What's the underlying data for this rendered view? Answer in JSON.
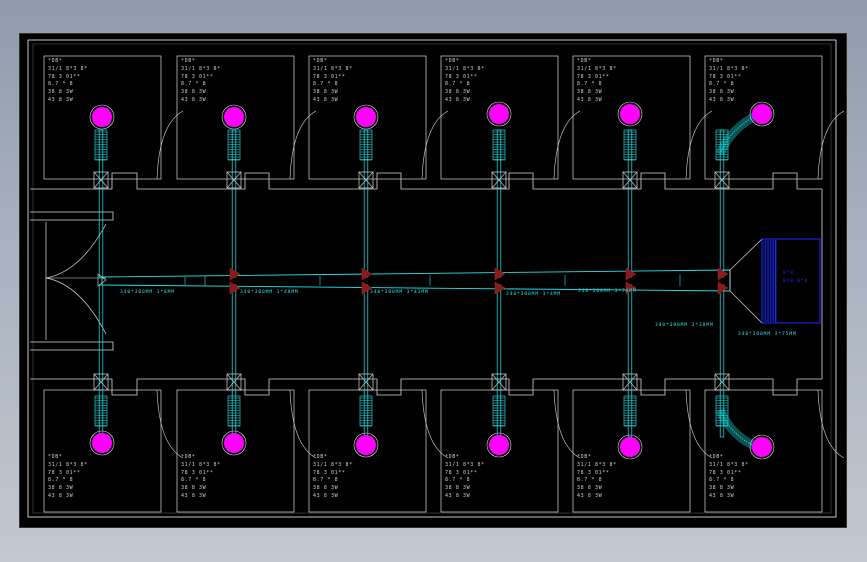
{
  "room_spec_lines": [
    "*DB*",
    "31/1 8*3 8*",
    "78 3 01**",
    "8.7 * 8",
    "38 8 3W",
    "43 8 3W"
  ],
  "duct_labels": [
    "340*300MM 3*8MM",
    "340*300MM 3*48MM",
    "340*300MM 3*43MM",
    "340*300MM 3*4MM",
    "340*300MM 3*70MM",
    "340*300MM 3*38MM",
    "340*300MM 3*75MM"
  ],
  "unit_label_lines": [
    "8*8",
    "878 8*8"
  ],
  "colors": {
    "duct": "#19e8ef",
    "wall": "#d9d9d9",
    "diffuser": "#ff00ff",
    "damper": "#8b1a1a",
    "unit": "#1a2cff"
  }
}
